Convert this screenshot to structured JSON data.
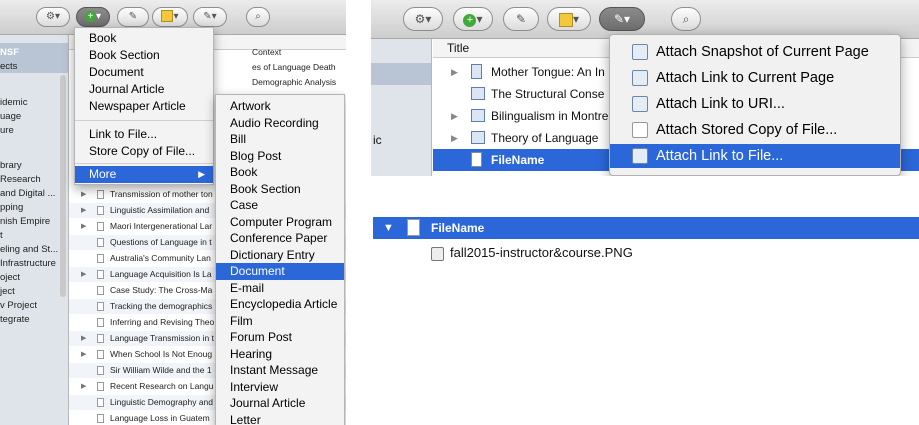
{
  "panelA": {
    "sidebar": {
      "items": [
        "NSF",
        "ects",
        "",
        "idemic",
        "uage",
        "ure",
        "",
        "brary",
        "Research",
        " and Digital ...",
        "pping",
        "nish Empire",
        "t",
        "eling and St...",
        "Infrastructure",
        "oject",
        "ject",
        "v Project",
        "tegrate"
      ]
    },
    "columns_right": [
      "Context",
      "es of Language Death",
      "Demographic Analysis"
    ],
    "rows": [
      "Transmission of mother ton",
      "Linguistic Assimilation and",
      "Maori Intergenerational Lar",
      "Questions of Language in t",
      "Australia's Community Lan",
      "Language Acquisition Is La",
      "Case Study: The Cross-Ma",
      "Tracking the demographics",
      "Inferring and Revising Theo",
      "Language Transmission in t",
      "When School Is Not Enoug",
      "Sir William Wilde and the 1",
      "Recent Research on Langu",
      "Linguistic Demography and",
      "Language Loss in Guatem"
    ],
    "new_item_menu": {
      "items": [
        "Book",
        "Book Section",
        "Document",
        "Journal Article",
        "Newspaper Article"
      ],
      "link_items": [
        "Link to File...",
        "Store Copy of File..."
      ],
      "more_label": "More",
      "more_arrow": "▶"
    },
    "more_submenu": {
      "items": [
        "Artwork",
        "Audio Recording",
        "Bill",
        "Blog Post",
        "Book",
        "Book Section",
        "Case",
        "Computer Program",
        "Conference Paper",
        "Dictionary Entry",
        "Document",
        "E-mail",
        "Encyclopedia Article",
        "Film",
        "Forum Post",
        "Hearing",
        "Instant Message",
        "Interview",
        "Journal Article",
        "Letter"
      ],
      "highlighted": "Document"
    },
    "toolbar": {
      "gear": "⚙",
      "plus": "+",
      "wand": "✎",
      "search": "⌕",
      "arrow": "▾"
    }
  },
  "panelB": {
    "column_header": "Title",
    "sidebar_fragment": "ic",
    "rows": [
      {
        "label": "Mother Tongue: An In",
        "icon": "book-icon",
        "arrow": "▶"
      },
      {
        "label": "The Structural Conse",
        "icon": "book-icon",
        "arrow": ""
      },
      {
        "label": "Bilingualism in Montre",
        "icon": "book-icon",
        "arrow": "▶"
      },
      {
        "label": "Theory  of Language",
        "icon": "book-icon",
        "arrow": "▶"
      },
      {
        "label": "FileName",
        "icon": "document-icon",
        "arrow": ""
      }
    ],
    "attach_menu": {
      "items": [
        "Attach Snapshot of Current Page",
        "Attach Link to Current Page",
        "Attach Link to URI...",
        "Attach Stored Copy of File...",
        "Attach Link to File..."
      ],
      "highlighted": "Attach Link to File..."
    },
    "toolbar": {
      "gear": "⚙",
      "plus": "+",
      "wand": "✎",
      "search": "⌕",
      "arrow": "▾"
    }
  },
  "panelC": {
    "parent": "FileName",
    "child": "fall2015-instructor&course.PNG",
    "expand_arrow": "▼"
  }
}
